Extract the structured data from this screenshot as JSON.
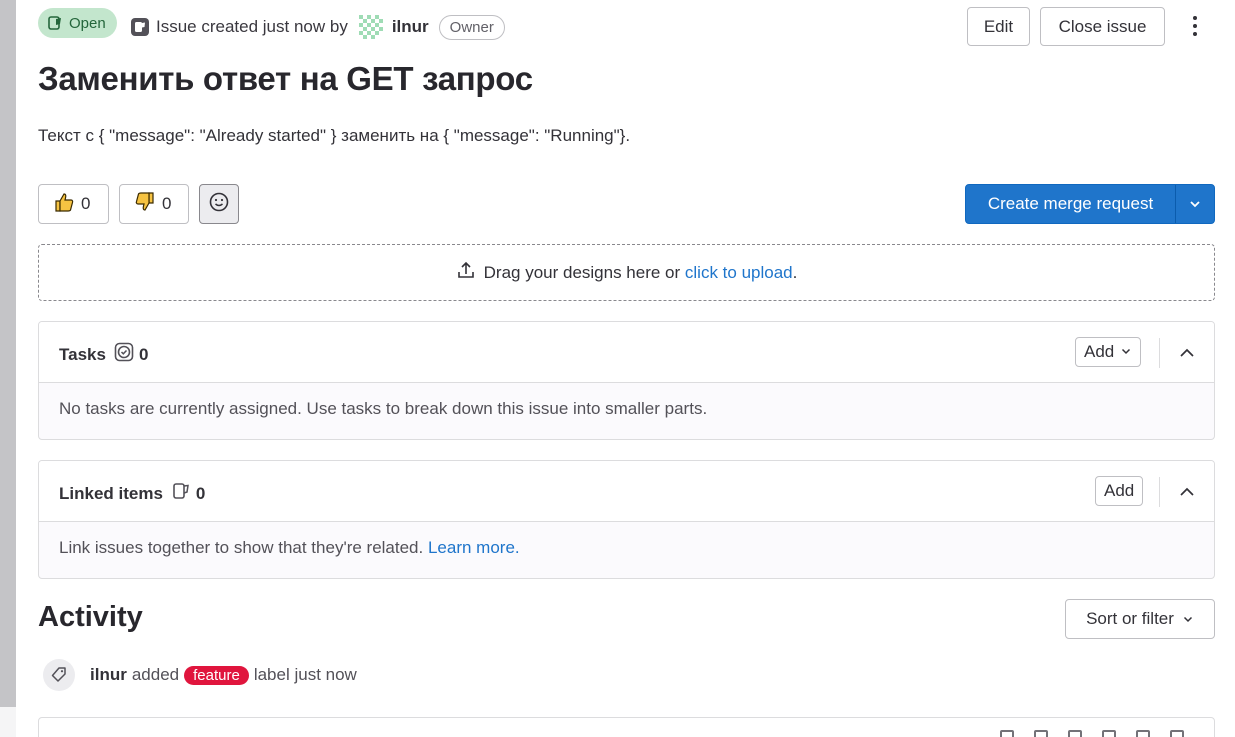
{
  "issue": {
    "status": "Open",
    "meta_prefix": "Issue created just now by",
    "author": "ilnur",
    "author_role": "Owner",
    "title": "Заменить ответ на GET запрос",
    "description": "Текст с { \"message\": \"Already started\" } заменить на { \"message\": \"Running\"}."
  },
  "actions": {
    "edit": "Edit",
    "close": "Close issue"
  },
  "reactions": {
    "thumbs_up_count": "0",
    "thumbs_down_count": "0"
  },
  "merge_request": {
    "label": "Create merge request"
  },
  "designs": {
    "text": "Drag your designs here or",
    "link": "click to upload",
    "suffix": "."
  },
  "tasks": {
    "title": "Tasks",
    "count": "0",
    "add": "Add",
    "empty": "No tasks are currently assigned. Use tasks to break down this issue into smaller parts."
  },
  "linked": {
    "title": "Linked items",
    "count": "0",
    "add": "Add",
    "empty": "Link issues together to show that they're related.",
    "learn_more": "Learn more."
  },
  "activity": {
    "title": "Activity",
    "sort": "Sort or filter",
    "item": {
      "author": "ilnur",
      "action": "added",
      "label": "feature",
      "suffix": "label just now"
    }
  },
  "colors": {
    "primary": "#1f75cb",
    "open_badge_bg": "#c3e6cd",
    "open_badge_text": "#24663b",
    "label_feature": "#e0153d"
  }
}
